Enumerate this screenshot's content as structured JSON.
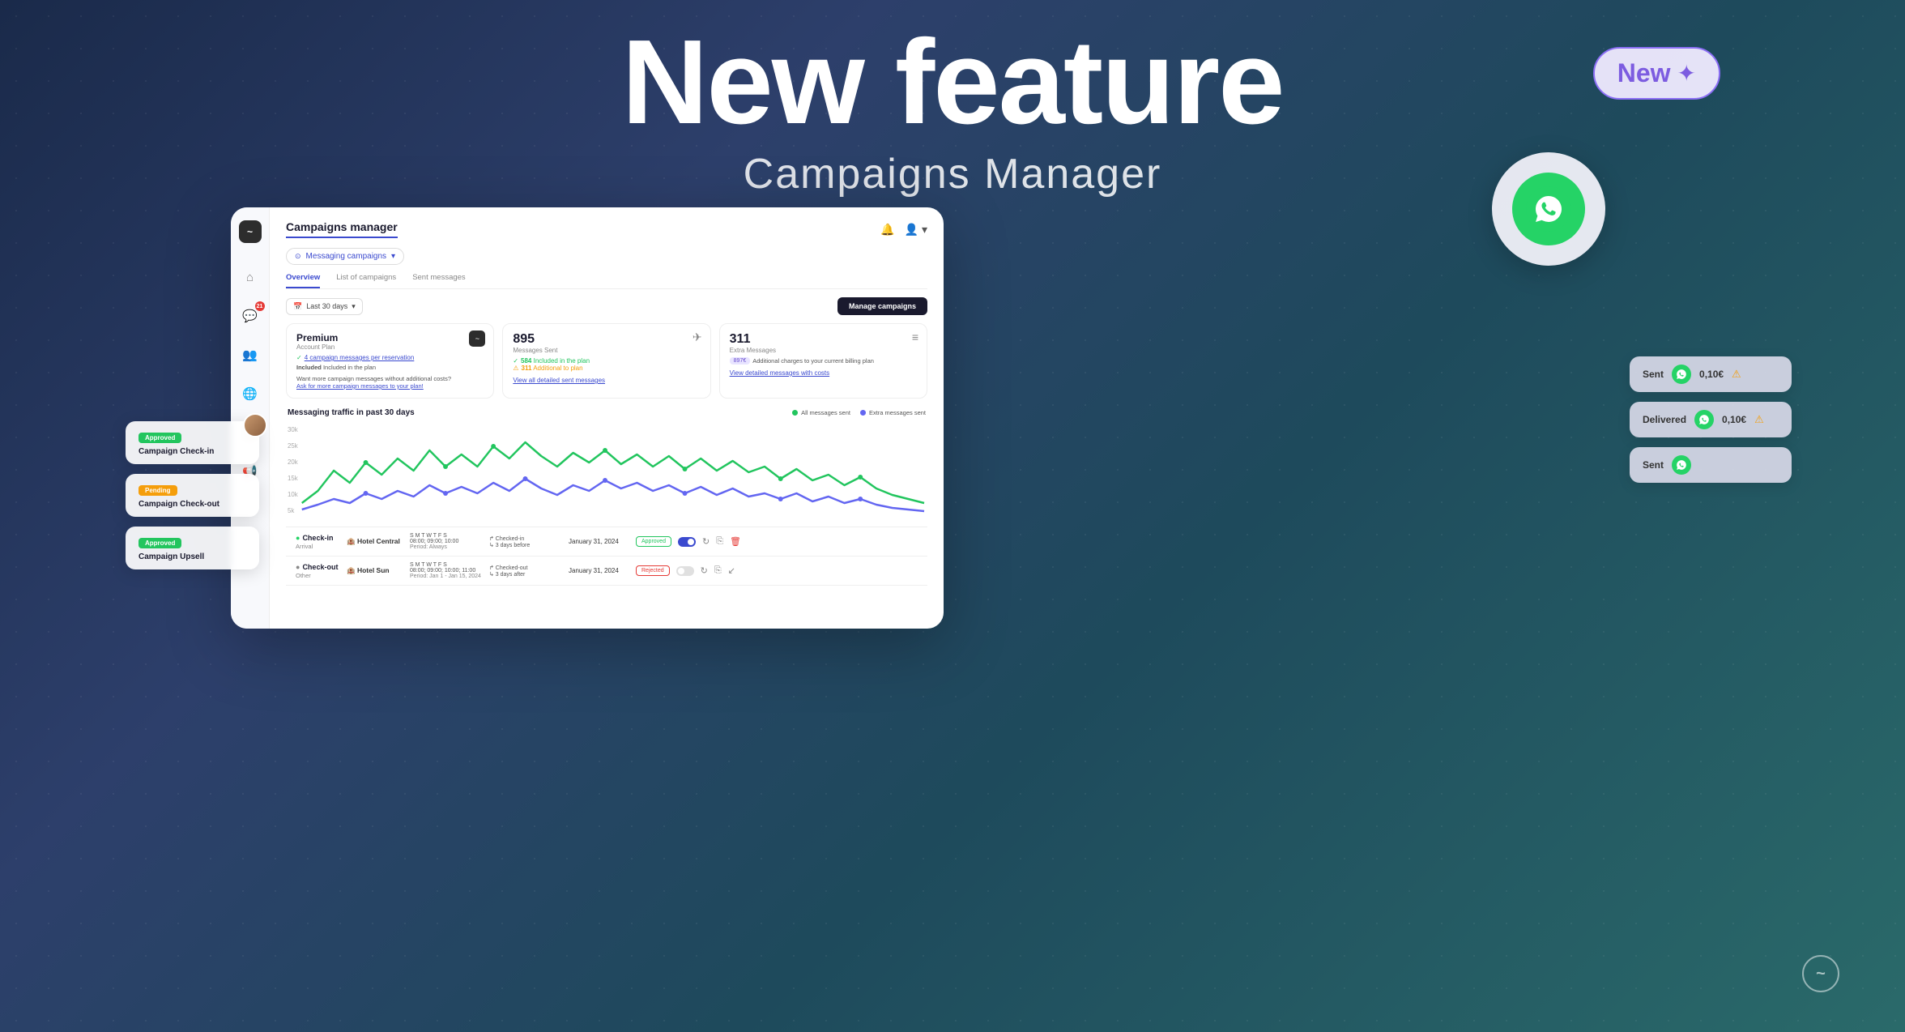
{
  "hero": {
    "title": "New feature",
    "subtitle": "Campaigns Manager"
  },
  "new_badge": {
    "label": "New",
    "star": "✦"
  },
  "sidebar": {
    "logo": "~",
    "items": [
      {
        "name": "home-icon",
        "icon": "⌂",
        "active": false
      },
      {
        "name": "chat-icon",
        "icon": "✉",
        "active": false,
        "badge": "21"
      },
      {
        "name": "users-icon",
        "icon": "👥",
        "active": false
      },
      {
        "name": "globe-icon",
        "icon": "⊕",
        "active": false
      },
      {
        "name": "calendar-icon",
        "icon": "⊞",
        "active": false
      },
      {
        "name": "megaphone-icon",
        "icon": "📢",
        "active": true
      }
    ]
  },
  "header": {
    "title": "Campaigns manager",
    "bell_icon": "🔔",
    "user_icon": "👤"
  },
  "messaging_dropdown": {
    "label": "Messaging campaigns",
    "chevron": "▾"
  },
  "tabs": [
    {
      "label": "Overview",
      "active": true
    },
    {
      "label": "List of campaigns",
      "active": false
    },
    {
      "label": "Sent messages",
      "active": false
    }
  ],
  "date_filter": {
    "label": "Last 30 days",
    "calendar_icon": "📅",
    "chevron": "▾"
  },
  "manage_btn": "Manage campaigns",
  "stats": {
    "plan": {
      "main_title": "Premium",
      "plan_label": "Account Plan",
      "green_text": "4 campaign messages per reservation",
      "included_text": "Included in the plan",
      "promo_line1": "Want more campaign messages without additional costs?",
      "promo_link": "Ask for more campaign messages to your plan!"
    },
    "messages": {
      "number": "895",
      "label": "Messages Sent",
      "included": "584",
      "included_text": "Included in the plan",
      "additional": "311",
      "additional_text": "Additional to plan",
      "link": "View all detailed sent messages"
    },
    "extra": {
      "number": "311",
      "label": "Extra Messages",
      "charge_amount": "897€",
      "charge_text": "Additional charges to your current billing plan",
      "link": "View detailed messages with costs"
    }
  },
  "chart": {
    "title": "Messaging traffic in past 30 days",
    "legend": [
      {
        "label": "All messages sent",
        "color": "green"
      },
      {
        "label": "Extra messages sent",
        "color": "purple"
      }
    ]
  },
  "table": {
    "rows": [
      {
        "name": "Check-in",
        "hotel": "Hotel Central",
        "schedule": "S M T W T F S",
        "time": "08:00; 09:00; 10:00",
        "period": "Period: Always",
        "event": "Checked-in",
        "days": "3 days before",
        "date": "January 31, 2024",
        "status": "Approved",
        "sub": "Arrival"
      },
      {
        "name": "Check-out",
        "hotel": "Hotel Sun",
        "schedule": "S M T W T F S",
        "time": "08:00; 09:00; 10:00; 11:00",
        "period": "Period: Jan 1 - Jan 15, 2024",
        "event": "Checked-out",
        "days": "3 days after",
        "date": "January 31, 2024",
        "status": "Rejected",
        "sub": "Other"
      }
    ]
  },
  "float_cards": [
    {
      "badge": "Approved",
      "badge_type": "approved",
      "name": "Campaign Check-in",
      "has_avatar": true
    },
    {
      "badge": "Pending",
      "badge_type": "pending",
      "name": "Campaign Check-out",
      "has_avatar": false
    },
    {
      "badge": "Approved",
      "badge_type": "approved",
      "name": "Campaign Upsell",
      "has_avatar": false
    }
  ],
  "notif_cards": [
    {
      "label": "Sent",
      "price": "0,10€",
      "has_warning": true
    },
    {
      "label": "Delivered",
      "price": "0,10€",
      "has_warning": true
    },
    {
      "label": "Sent",
      "price": "",
      "has_warning": false
    }
  ]
}
